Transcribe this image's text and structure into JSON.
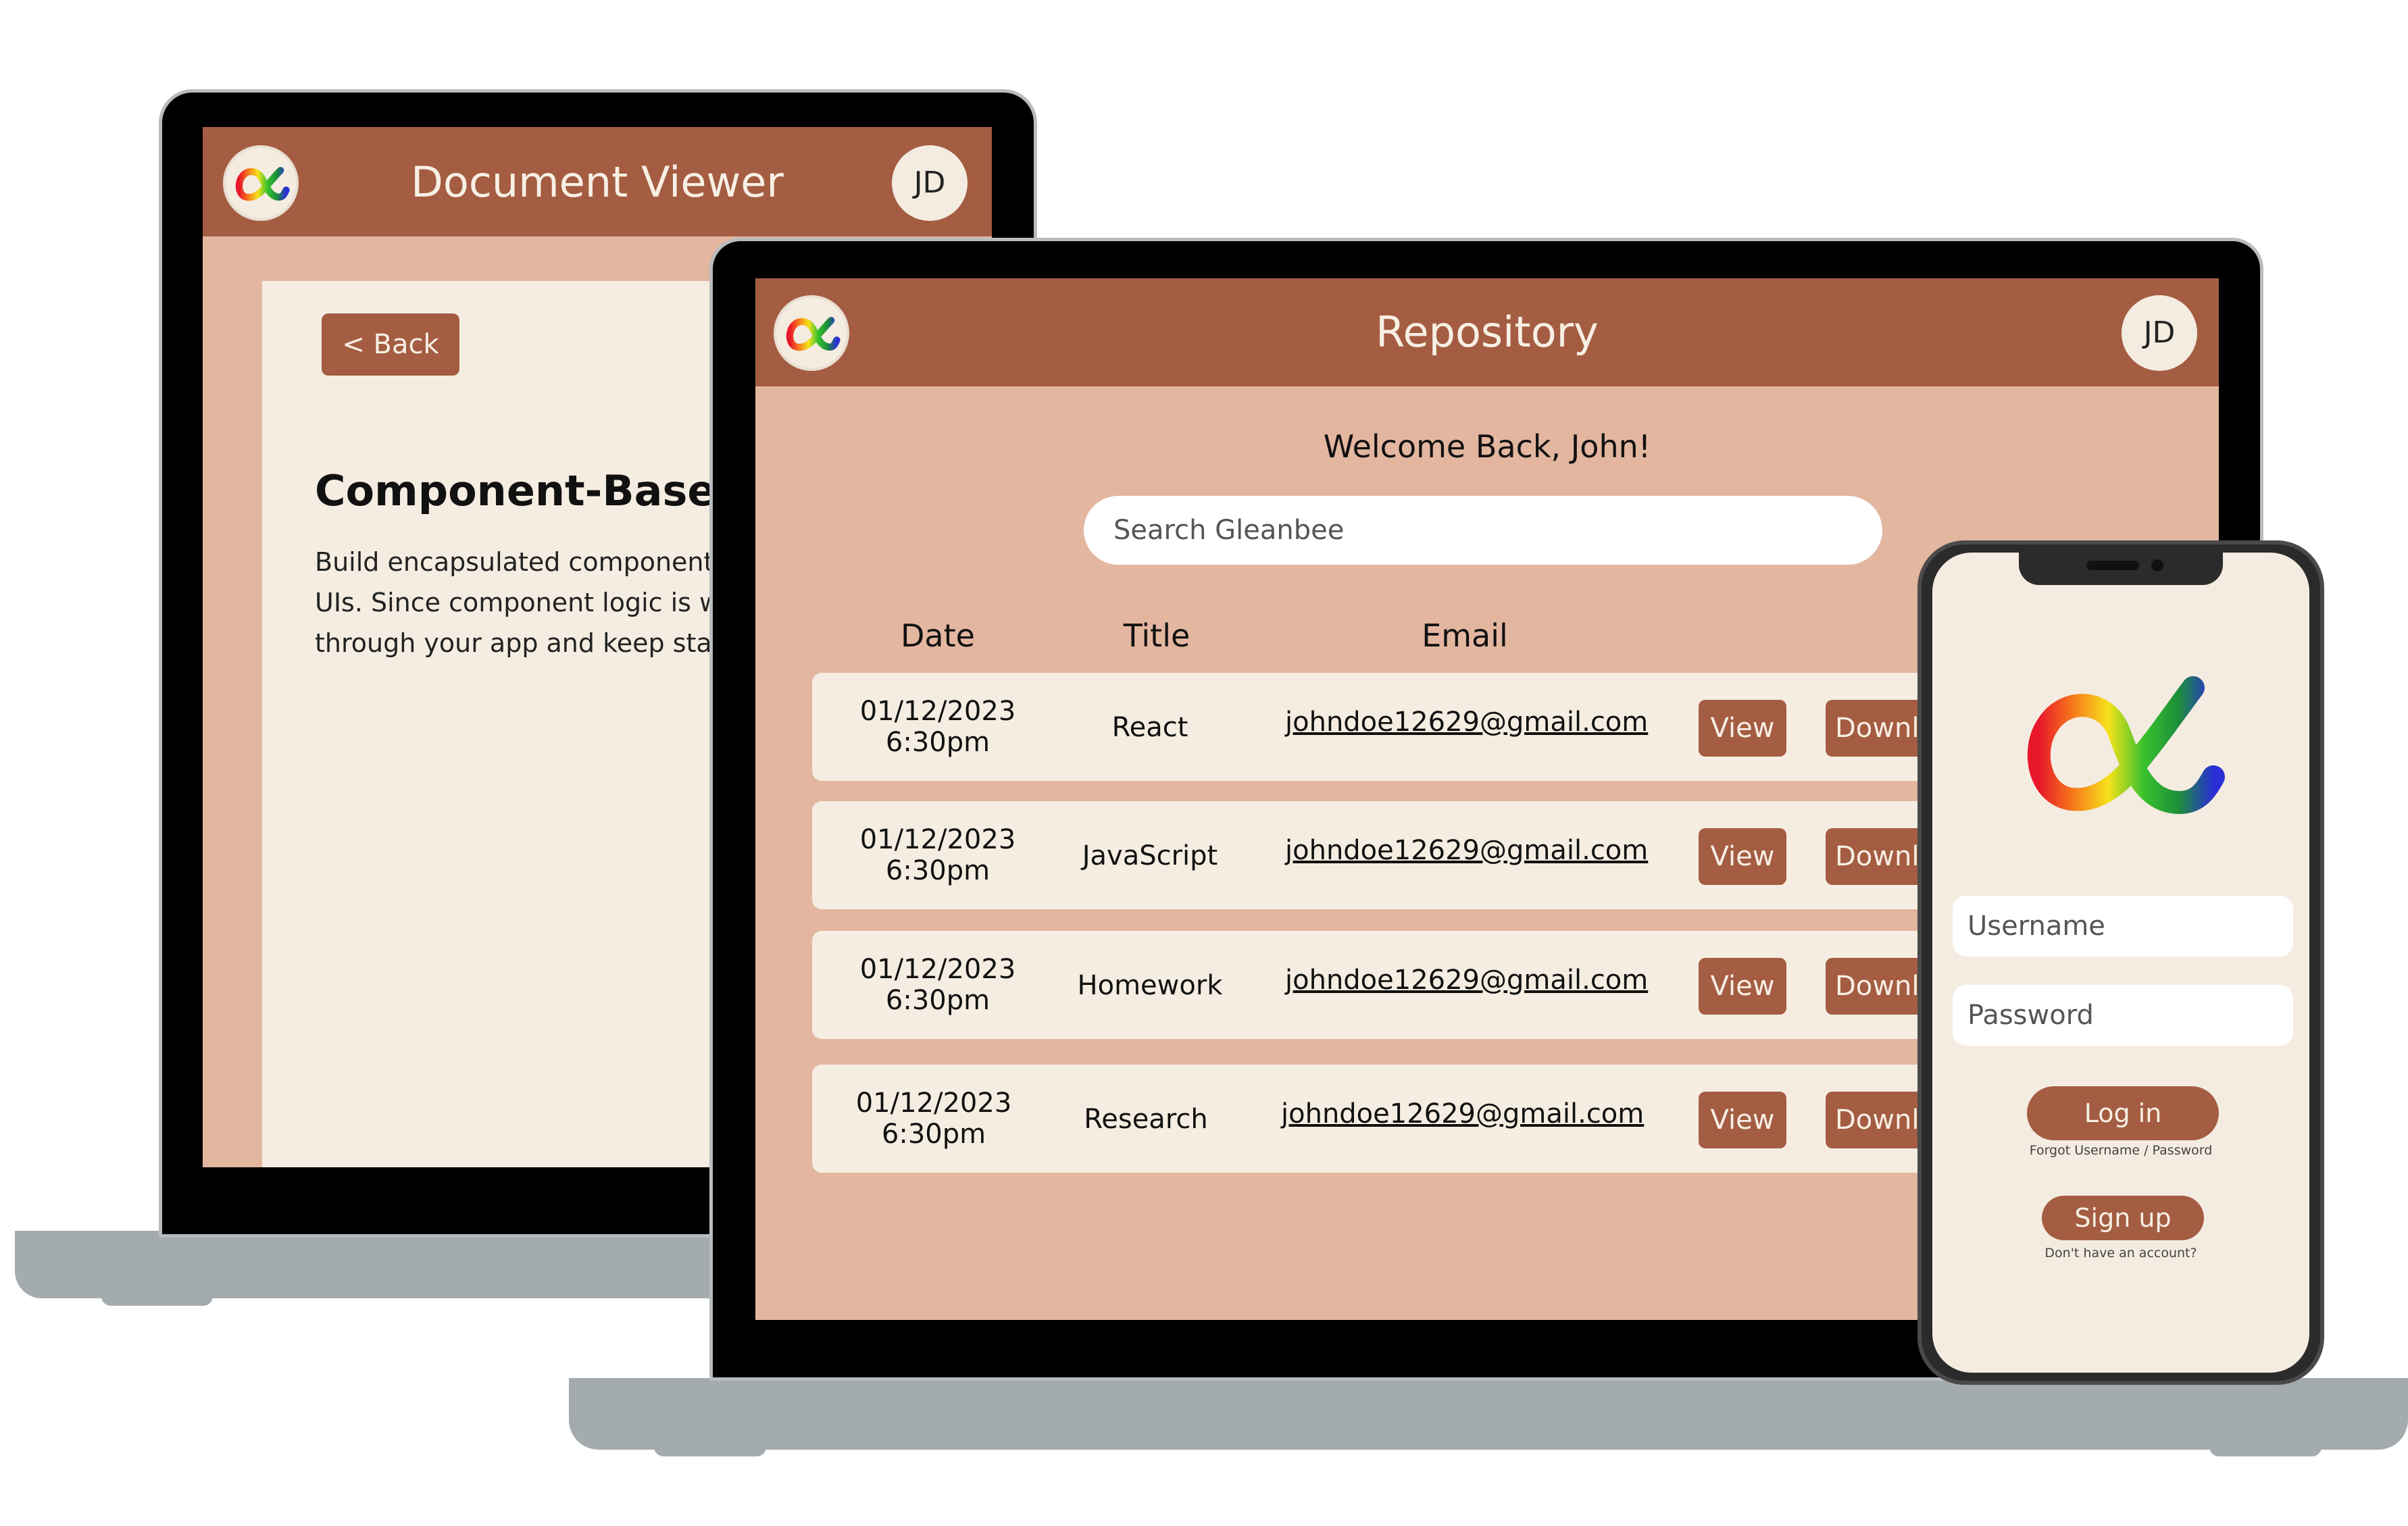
{
  "colors": {
    "header": "#a45d42",
    "page_bg": "#e3b6a0",
    "card": "#f5ede1",
    "button": "#a45d42",
    "bezel": "#000000",
    "laptop_base": "#a4abaf"
  },
  "icons": {
    "logo": "rainbow-alpha-infinity-logo"
  },
  "doc_viewer": {
    "title": "Document Viewer",
    "avatar": "JD",
    "back_label": "< Back",
    "heading": "Component-Based",
    "body_lines": [
      "Build encapsulated components t",
      "UIs. Since component logic is wri",
      "through your app and keep state"
    ]
  },
  "repository": {
    "title": "Repository",
    "avatar": "JD",
    "welcome": "Welcome Back, John!",
    "search_placeholder": "Search Gleanbee",
    "columns": {
      "date": "Date",
      "title": "Title",
      "email": "Email"
    },
    "view_label": "View",
    "download_label": "Downlo",
    "rows": [
      {
        "date": "01/12/2023",
        "time": "6:30pm",
        "title": "React",
        "email": "johndoe12629@gmail.com"
      },
      {
        "date": "01/12/2023",
        "time": "6:30pm",
        "title": "JavaScript",
        "email": "johndoe12629@gmail.com"
      },
      {
        "date": "01/12/2023",
        "time": "6:30pm",
        "title": "Homework",
        "email": "johndoe12629@gmail.com"
      },
      {
        "date": "01/12/2023",
        "time": "6:30pm",
        "title": "Research",
        "email": "johndoe12629@gmail.com"
      }
    ]
  },
  "phone": {
    "username_placeholder": "Username",
    "password_placeholder": "Password",
    "login_label": "Log in",
    "forgot_text": "Forgot Username / Password",
    "signup_label": "Sign up",
    "no_account_text": "Don't have an account?"
  }
}
